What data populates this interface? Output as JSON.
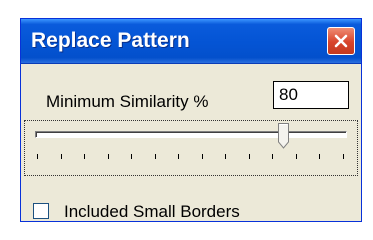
{
  "window": {
    "title": "Replace Pattern",
    "close_icon": "close-icon"
  },
  "similarity": {
    "label": "Minimum Similarity %",
    "value": "80"
  },
  "slider": {
    "value_fraction": 0.8,
    "tick_count": 14
  },
  "options": {
    "small_borders_label": "Included Small Borders",
    "small_borders_checked": false
  },
  "colors": {
    "title_bar": "#0454d4",
    "close_button": "#d8442b",
    "window_bg": "#ece9d8"
  }
}
